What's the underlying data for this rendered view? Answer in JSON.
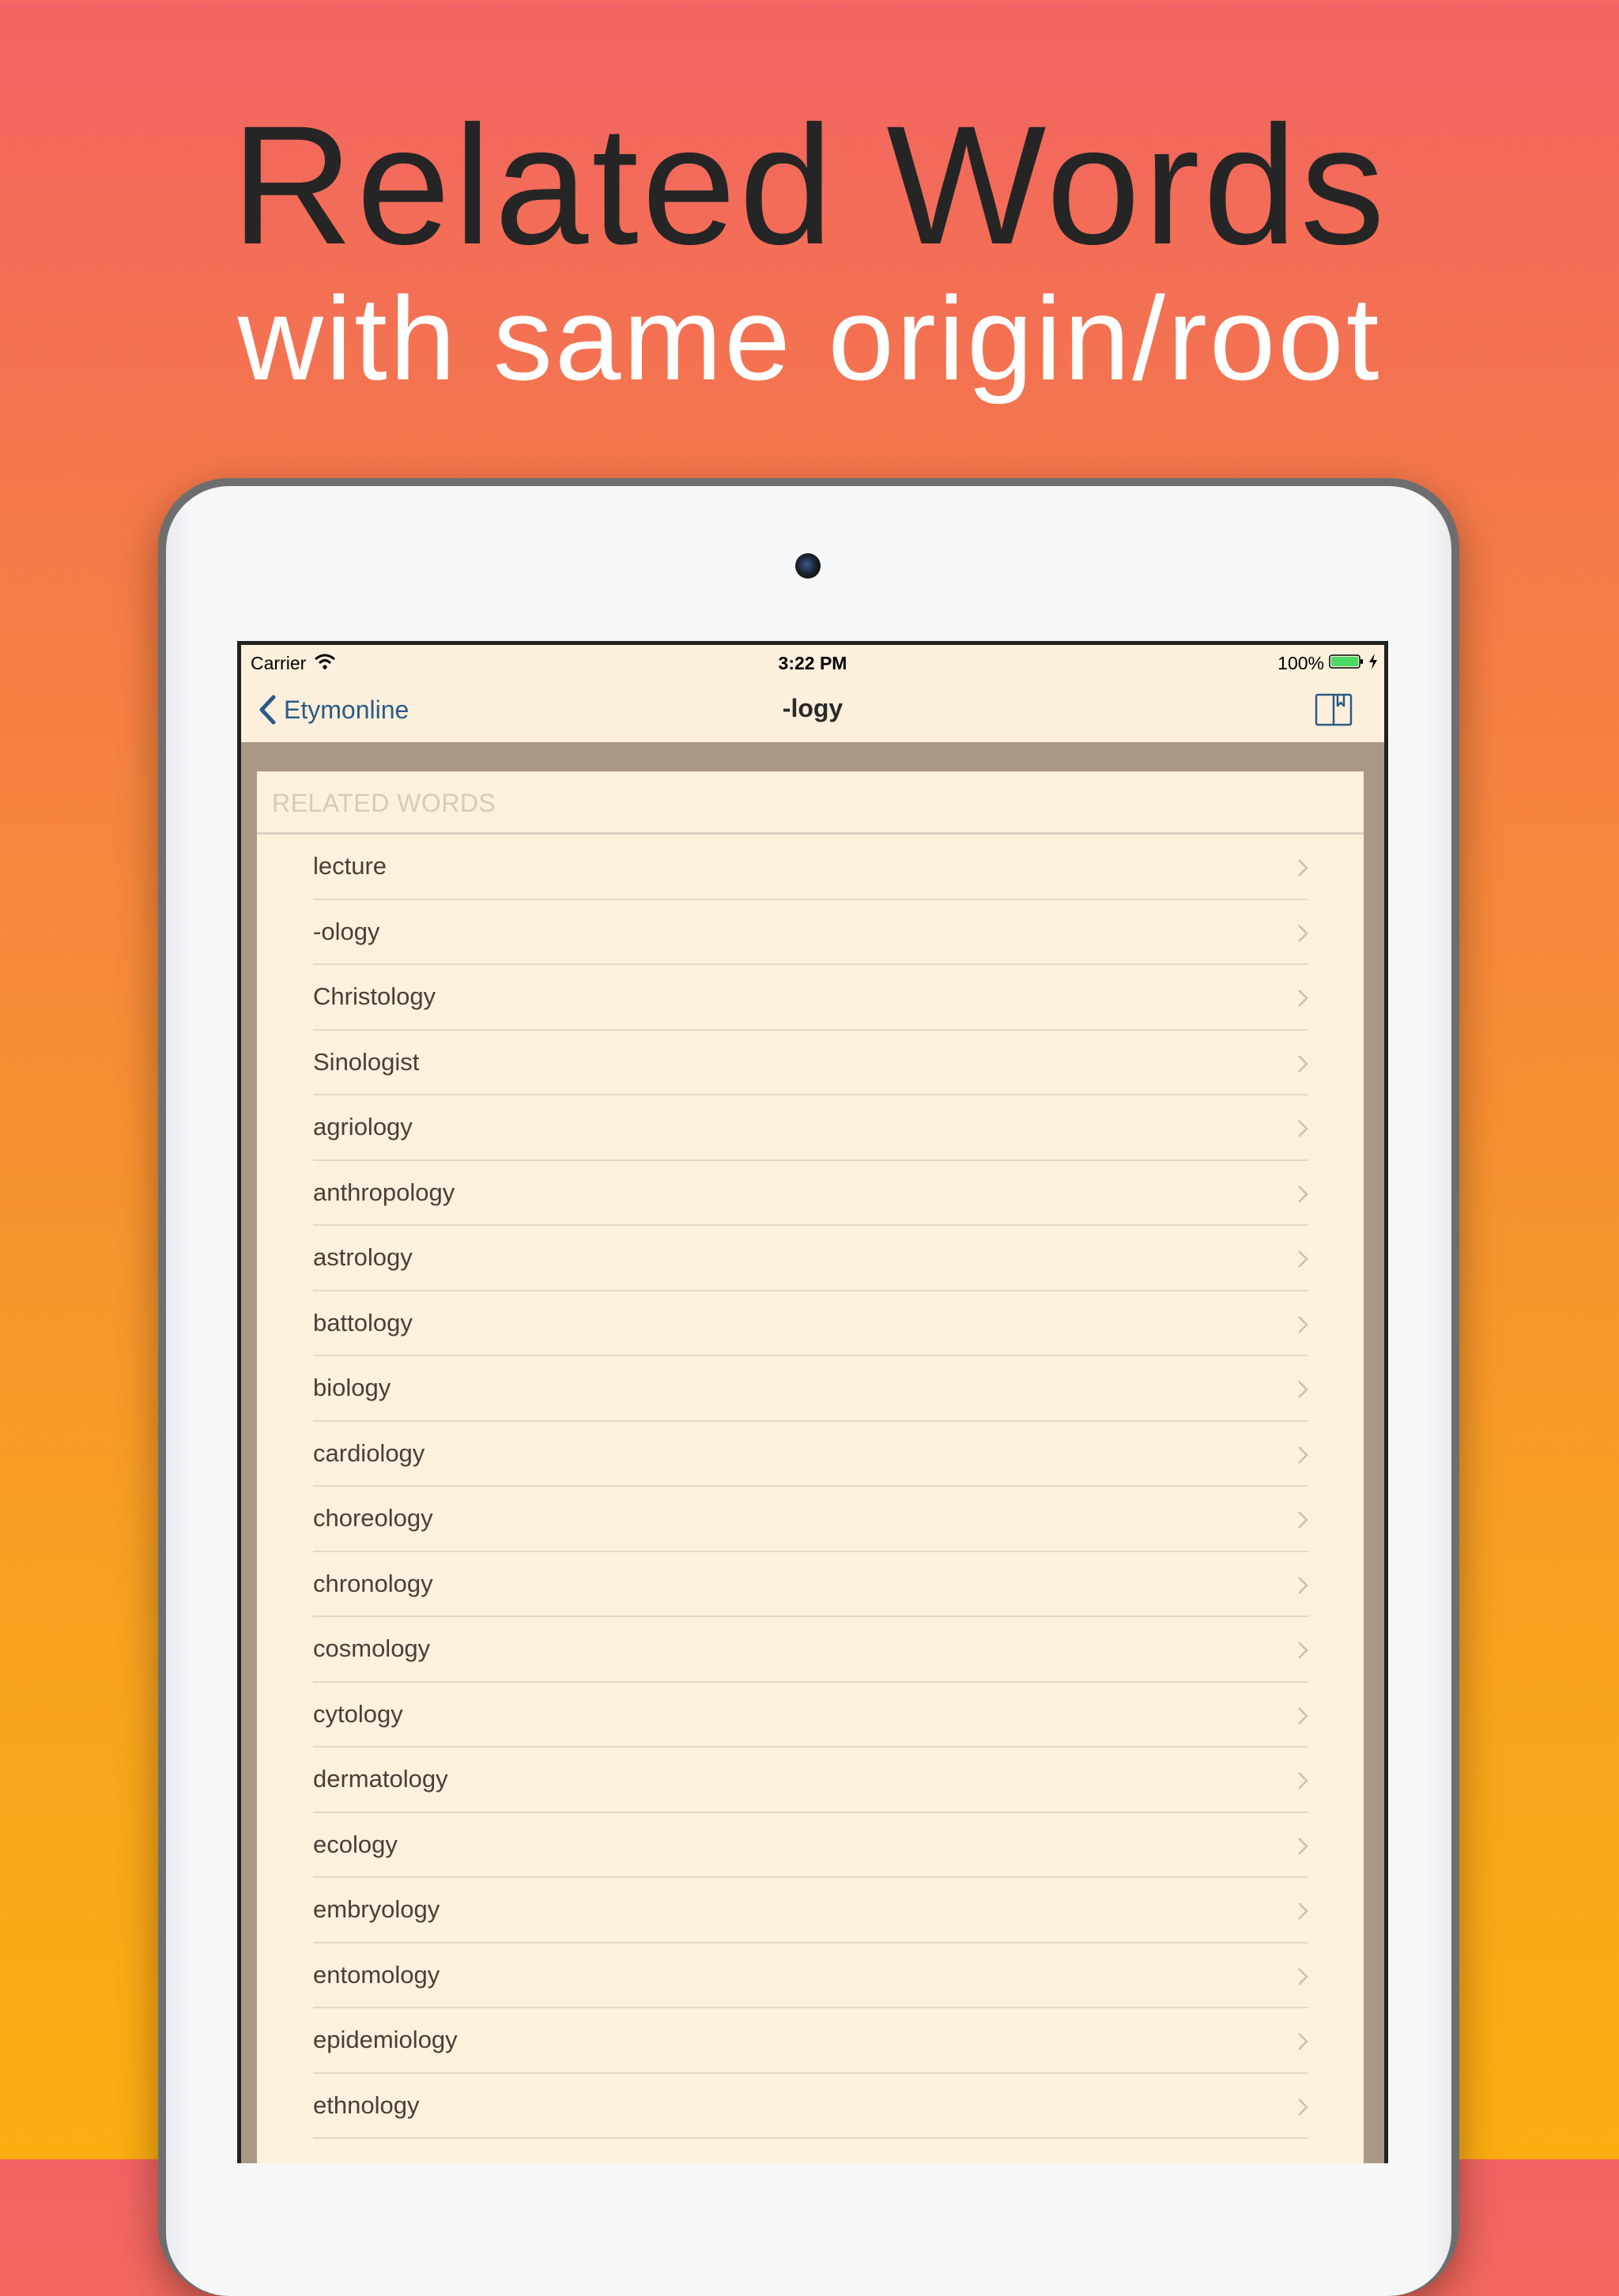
{
  "promo": {
    "headline": "Related Words",
    "subline": "with same origin/root"
  },
  "status_bar": {
    "carrier": "Carrier",
    "time": "3:22 PM",
    "battery": "100%"
  },
  "nav": {
    "back_label": "Etymonline",
    "title": "-logy",
    "bookmark_icon": "book-bookmark-icon"
  },
  "section": {
    "header": "RELATED WORDS",
    "items": [
      "lecture",
      "-ology",
      "Christology",
      "Sinologist",
      "agriology",
      "anthropology",
      "astrology",
      "battology",
      "biology",
      "cardiology",
      "choreology",
      "chronology",
      "cosmology",
      "cytology",
      "dermatology",
      "ecology",
      "embryology",
      "entomology",
      "epidemiology",
      "ethnology"
    ]
  },
  "colors": {
    "accent": "#2b5a86",
    "background_top": "#f26363",
    "background_bottom": "#fbad10",
    "cell_background": "#fcf1dc",
    "table_background": "#a99884",
    "battery_fill": "#4cd964"
  }
}
